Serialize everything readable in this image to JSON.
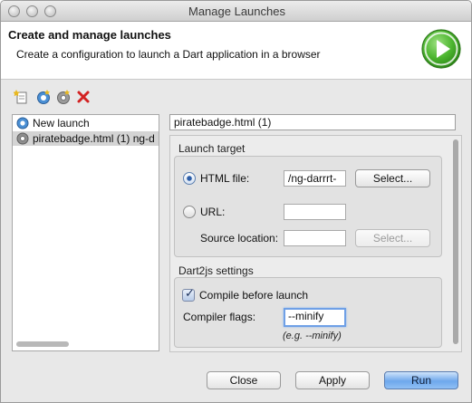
{
  "window": {
    "title": "Manage Launches"
  },
  "banner": {
    "title": "Create and manage launches",
    "description": "Create a configuration to launch a Dart application in a browser",
    "icon": "run-play-icon",
    "accent": "#3fae2a"
  },
  "toolbar": {
    "items": [
      {
        "icon": "new-launch-icon",
        "tooltip": ""
      },
      {
        "icon": "new-dart-launch-icon",
        "tooltip": ""
      },
      {
        "icon": "new-chrome-launch-icon",
        "tooltip": ""
      },
      {
        "icon": "delete-icon",
        "tooltip": ""
      }
    ]
  },
  "launch_list": {
    "items": [
      {
        "label": "New launch",
        "icon": "dart-launch-icon",
        "selected": false
      },
      {
        "label": "piratebadge.html (1) ng-d",
        "icon": "browser-launch-icon",
        "selected": true
      }
    ]
  },
  "config": {
    "name": "piratebadge.html (1)",
    "launch_target": {
      "label": "Launch target",
      "html_file_label": "HTML file:",
      "html_file_value": "/ng-darrrt-",
      "html_file_selected": true,
      "select_label": "Select...",
      "url_label": "URL:",
      "url_value": "",
      "source_location_label": "Source location:",
      "source_location_value": "",
      "source_select_label": "Select..."
    },
    "dart2js": {
      "label": "Dart2js settings",
      "compile_label": "Compile before launch",
      "compile_checked": true,
      "flags_label": "Compiler flags:",
      "flags_value": "--minify",
      "flags_hint": "(e.g. --minify)"
    }
  },
  "buttons": {
    "close": "Close",
    "apply": "Apply",
    "run": "Run"
  }
}
